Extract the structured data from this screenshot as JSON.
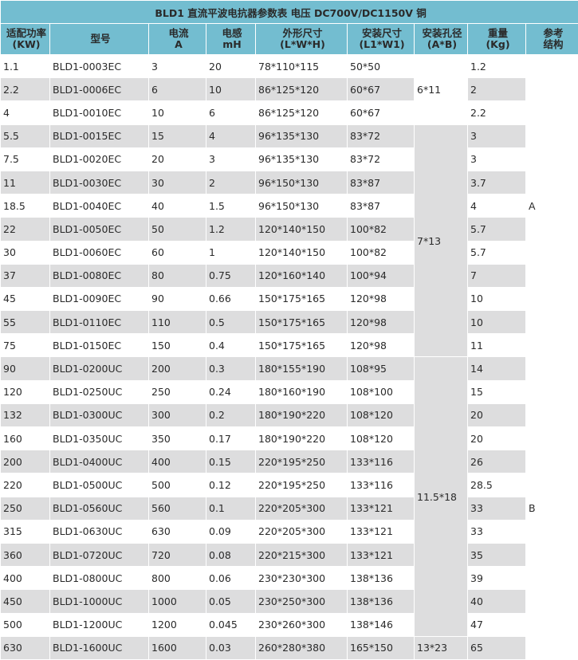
{
  "title": "BLD1 直流平波电抗器参数表  电压 DC700V/DC1150V  铜",
  "headers": [
    {
      "line1": "适配功率",
      "line2": "(KW)"
    },
    {
      "line1": "型号",
      "line2": ""
    },
    {
      "line1": "电流",
      "line2": "A"
    },
    {
      "line1": "电感",
      "line2": "mH"
    },
    {
      "line1": "外形尺寸",
      "line2": "(L*W*H)"
    },
    {
      "line1": "安装尺寸",
      "line2": "(L1*W1)"
    },
    {
      "line1": "安装孔径",
      "line2": "(A*B)"
    },
    {
      "line1": "重量",
      "line2": "(Kg)"
    },
    {
      "line1": "参考",
      "line2": "结构"
    }
  ],
  "rows": [
    {
      "kw": "1.1",
      "model": "BLD1-0003EC",
      "current": "3",
      "inductance": "20",
      "dims": "78*110*115",
      "mount": "50*50",
      "weight": "1.2"
    },
    {
      "kw": "2.2",
      "model": "BLD1-0006EC",
      "current": "6",
      "inductance": "10",
      "dims": "86*125*120",
      "mount": "60*67",
      "weight": "2"
    },
    {
      "kw": "4",
      "model": "BLD1-0010EC",
      "current": "10",
      "inductance": "6",
      "dims": "86*125*120",
      "mount": "60*67",
      "weight": "2.2"
    },
    {
      "kw": "5.5",
      "model": "BLD1-0015EC",
      "current": "15",
      "inductance": "4",
      "dims": "96*135*130",
      "mount": "83*72",
      "weight": "3"
    },
    {
      "kw": "7.5",
      "model": "BLD1-0020EC",
      "current": "20",
      "inductance": "3",
      "dims": "96*135*130",
      "mount": "83*72",
      "weight": "3"
    },
    {
      "kw": "11",
      "model": "BLD1-0030EC",
      "current": "30",
      "inductance": "2",
      "dims": "96*150*130",
      "mount": "83*87",
      "weight": "3.7"
    },
    {
      "kw": "18.5",
      "model": "BLD1-0040EC",
      "current": "40",
      "inductance": "1.5",
      "dims": "96*150*130",
      "mount": "83*87",
      "weight": "4"
    },
    {
      "kw": "22",
      "model": "BLD1-0050EC",
      "current": "50",
      "inductance": "1.2",
      "dims": "120*140*150",
      "mount": "100*82",
      "weight": "5.7"
    },
    {
      "kw": "30",
      "model": "BLD1-0060EC",
      "current": "60",
      "inductance": "1",
      "dims": "120*140*150",
      "mount": "100*82",
      "weight": "5.7"
    },
    {
      "kw": "37",
      "model": "BLD1-0080EC",
      "current": "80",
      "inductance": "0.75",
      "dims": "120*160*140",
      "mount": "100*94",
      "weight": "7"
    },
    {
      "kw": "45",
      "model": "BLD1-0090EC",
      "current": "90",
      "inductance": "0.66",
      "dims": "150*175*165",
      "mount": "120*98",
      "weight": "10"
    },
    {
      "kw": "55",
      "model": "BLD1-0110EC",
      "current": "110",
      "inductance": "0.5",
      "dims": "150*175*165",
      "mount": "120*98",
      "weight": "10"
    },
    {
      "kw": "75",
      "model": "BLD1-0150EC",
      "current": "150",
      "inductance": "0.4",
      "dims": "150*175*165",
      "mount": "120*98",
      "weight": "11"
    },
    {
      "kw": "90",
      "model": "BLD1-0200UC",
      "current": "200",
      "inductance": "0.3",
      "dims": "180*155*190",
      "mount": "108*95",
      "weight": "14"
    },
    {
      "kw": "120",
      "model": "BLD1-0250UC",
      "current": "250",
      "inductance": "0.24",
      "dims": "180*160*190",
      "mount": "108*100",
      "weight": "15"
    },
    {
      "kw": "132",
      "model": "BLD1-0300UC",
      "current": "300",
      "inductance": "0.2",
      "dims": "180*190*220",
      "mount": "108*120",
      "weight": "20"
    },
    {
      "kw": "160",
      "model": "BLD1-0350UC",
      "current": "350",
      "inductance": "0.17",
      "dims": "180*190*220",
      "mount": "108*120",
      "weight": "20"
    },
    {
      "kw": "200",
      "model": "BLD1-0400UC",
      "current": "400",
      "inductance": "0.15",
      "dims": "220*195*250",
      "mount": "133*116",
      "weight": "26"
    },
    {
      "kw": "220",
      "model": "BLD1-0500UC",
      "current": "500",
      "inductance": "0.12",
      "dims": "220*195*250",
      "mount": "133*116",
      "weight": "28.5"
    },
    {
      "kw": "250",
      "model": "BLD1-0560UC",
      "current": "560",
      "inductance": "0.1",
      "dims": "220*205*300",
      "mount": "133*121",
      "weight": "33"
    },
    {
      "kw": "315",
      "model": "BLD1-0630UC",
      "current": "630",
      "inductance": "0.09",
      "dims": "220*205*300",
      "mount": "133*121",
      "weight": "33"
    },
    {
      "kw": "360",
      "model": "BLD1-0720UC",
      "current": "720",
      "inductance": "0.08",
      "dims": "220*215*300",
      "mount": "133*121",
      "weight": "35"
    },
    {
      "kw": "400",
      "model": "BLD1-0800UC",
      "current": "800",
      "inductance": "0.06",
      "dims": "230*230*300",
      "mount": "138*136",
      "weight": "39"
    },
    {
      "kw": "450",
      "model": "BLD1-1000UC",
      "current": "1000",
      "inductance": "0.05",
      "dims": "230*250*300",
      "mount": "138*136",
      "weight": "40"
    },
    {
      "kw": "500",
      "model": "BLD1-1200UC",
      "current": "1200",
      "inductance": "0.045",
      "dims": "230*260*300",
      "mount": "138*146",
      "weight": "47"
    },
    {
      "kw": "630",
      "model": "BLD1-1600UC",
      "current": "1600",
      "inductance": "0.03",
      "dims": "260*280*380",
      "mount": "165*150",
      "weight": "65"
    }
  ],
  "hole_groups": [
    "6*11",
    "7*13",
    "11.5*18",
    "13*23"
  ],
  "structure_groups": [
    "A",
    "B"
  ],
  "colors": {
    "header_bg": "#73bdd0",
    "stripe": "#ddddde",
    "text": "#2a2a2a"
  }
}
